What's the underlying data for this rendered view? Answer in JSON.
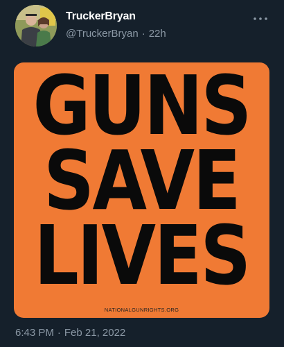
{
  "tweet": {
    "display_name": "TruckerBryan",
    "handle": "@TruckerBryan",
    "separator": "·",
    "relative_time": "22h",
    "more_icon": "more-horizontal-icon",
    "media": {
      "lines": [
        "GUNS",
        "SAVE",
        "LIVES"
      ],
      "watermark": "NATIONALGUNRIGHTS.ORG",
      "background": "#f07a34",
      "text_color": "#0a0a0a"
    },
    "time": "6:43 PM",
    "date": "Feb 21, 2022"
  },
  "theme": {
    "background": "#15202b",
    "secondary_text": "#8b98a5"
  }
}
